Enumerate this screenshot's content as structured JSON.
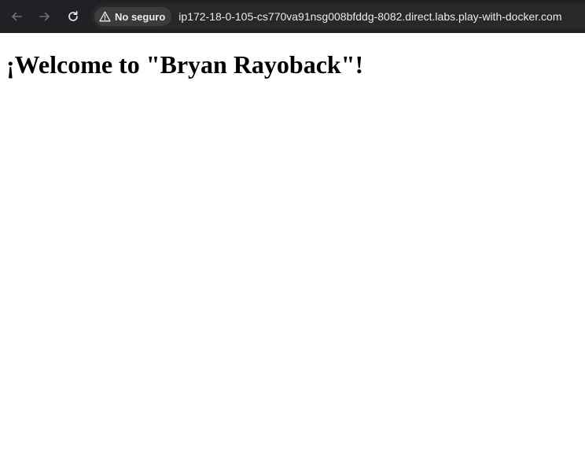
{
  "browser": {
    "security_label": "No seguro",
    "url": "ip172-18-0-105-cs770va91nsg008bfddg-8082.direct.labs.play-with-docker.com",
    "icons": {
      "back": "arrow-left-icon",
      "forward": "arrow-right-icon",
      "reload": "reload-icon",
      "security": "warning-triangle-icon"
    },
    "colors": {
      "toolbar_bg": "#202124",
      "omnibox_bg": "#282828",
      "chip_bg": "#3c3c3c",
      "text": "#e8eaed",
      "disabled_icon": "#6f7174"
    }
  },
  "page": {
    "heading": "¡Welcome to \"Bryan Rayoback\"!"
  }
}
